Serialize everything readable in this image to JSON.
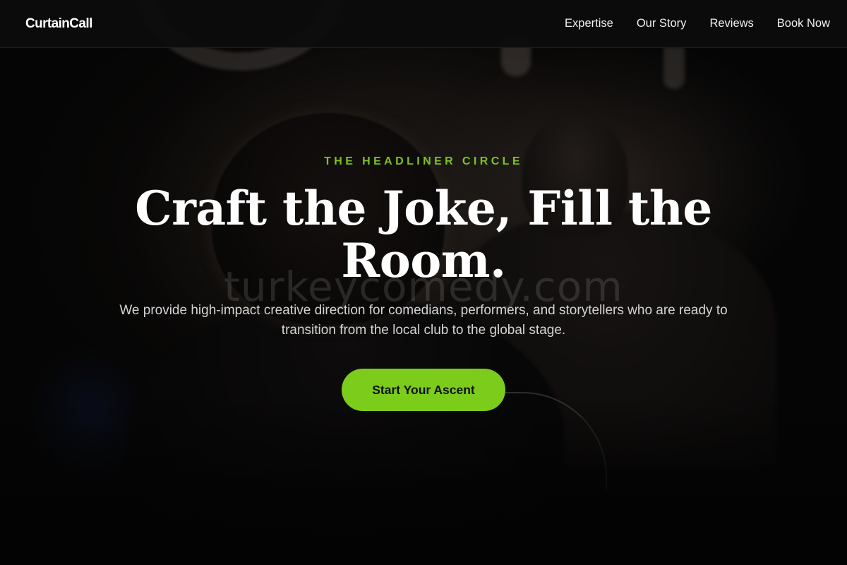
{
  "nav": {
    "brand": "CurtainCall",
    "links": [
      "Expertise",
      "Our Story",
      "Reviews",
      "Book Now"
    ]
  },
  "hero": {
    "eyebrow": "THE HEADLINER CIRCLE",
    "headline": "Craft the Joke, Fill the Room.",
    "description": "We provide high-impact creative direction for comedians, performers, and storytellers who are ready to transition from the local club to the global stage.",
    "cta_label": "Start Your Ascent",
    "watermark": "turkeycomedy.com"
  },
  "colors": {
    "accent": "#7ccc1c",
    "eyebrow": "#7cc41f",
    "navbar_bg": "#0c0c0c",
    "text": "#ffffff"
  }
}
